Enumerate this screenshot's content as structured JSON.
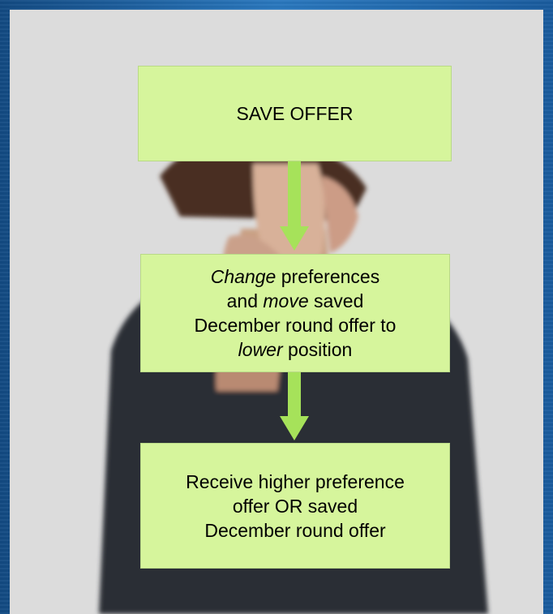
{
  "steps": {
    "save_offer": "SAVE OFFER",
    "change": {
      "line1_em": "Change",
      "line1_rest": " preferences",
      "line2_pre": "and ",
      "line2_em": "move",
      "line2_rest": " saved",
      "line3": "December round offer to",
      "line4_em": "lower",
      "line4_rest": " position"
    },
    "receive": {
      "line1": "Receive higher preference",
      "line2": "offer OR saved",
      "line3": "December round offer"
    }
  },
  "colors": {
    "box_fill": "#d6f59c",
    "arrow": "#a6e25a",
    "background": "#1f6ab0"
  },
  "icons": [
    "down-arrow-icon",
    "down-arrow-icon"
  ]
}
